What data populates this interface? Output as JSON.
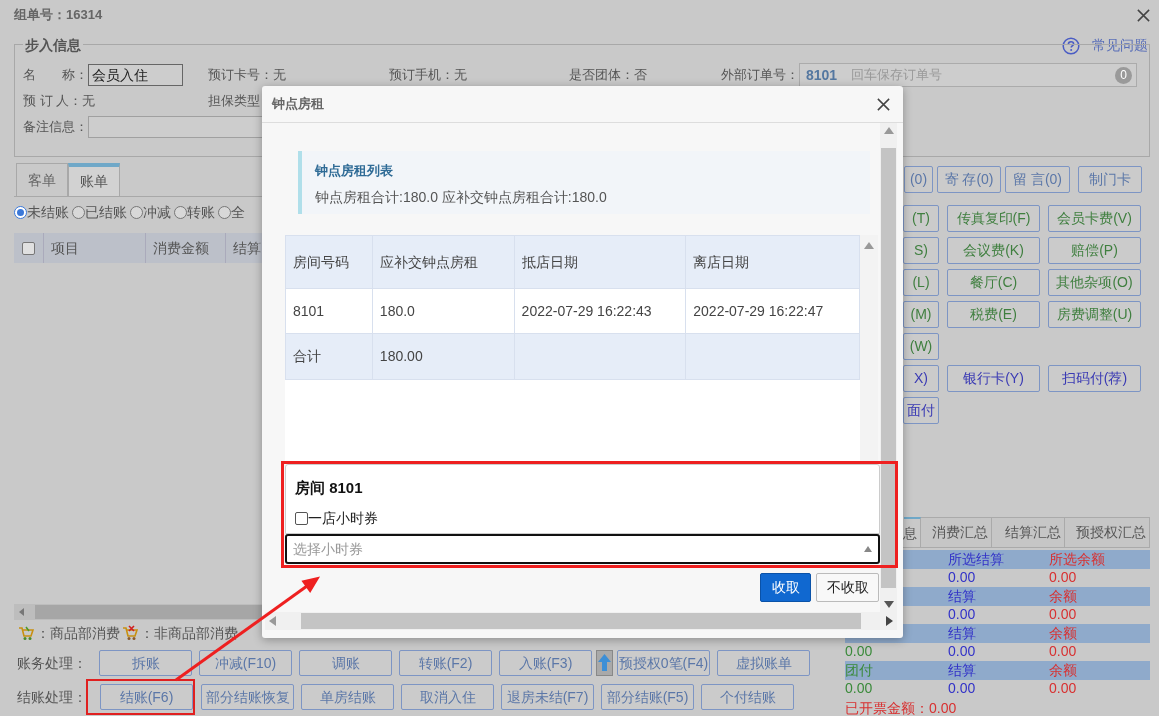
{
  "window": {
    "title": "组单号：16314",
    "help_link": "常见问题"
  },
  "walk_in": {
    "legend": "步入信息",
    "rows": [
      [
        {
          "kind": "input",
          "label": "名　　称：",
          "value": "会员入住"
        },
        {
          "kind": "text",
          "label": "预订卡号：",
          "value": "无"
        },
        {
          "kind": "text",
          "label": "预订手机：",
          "value": "无"
        },
        {
          "kind": "text",
          "label": "是否团体：",
          "value": "否"
        },
        {
          "kind": "order_input",
          "label": "外部订单号：",
          "value": "8101",
          "hint": "回车保存订单号",
          "badge": "0"
        }
      ],
      [
        {
          "kind": "text",
          "label": "预 订 人：",
          "value": "无"
        },
        {
          "kind": "text",
          "label": "担保类型"
        }
      ],
      [
        {
          "kind": "input",
          "label": "备注信息："
        }
      ]
    ]
  },
  "tabs": [
    {
      "label": "客单",
      "selected": false
    },
    {
      "label": "账单",
      "selected": true
    }
  ],
  "bill_filters": [
    {
      "label": "未结账",
      "selected": true
    },
    {
      "label": "已结账",
      "selected": false
    },
    {
      "label": "冲减",
      "selected": false
    },
    {
      "label": "转账",
      "selected": false
    },
    {
      "label": "全",
      "selected": false
    }
  ],
  "bill_table": {
    "checked": false,
    "columns": [
      "项目",
      "消费金额",
      "结算"
    ]
  },
  "legend": [
    {
      "kind": "cart",
      "label": "：商品部消费"
    },
    {
      "kind": "cart_cross",
      "label": "：非商品部消费"
    }
  ],
  "account_actions": {
    "label": "账务处理：",
    "buttons": [
      {
        "kind": "text",
        "label": "拆账"
      },
      {
        "kind": "text",
        "label": "冲减(F10)"
      },
      {
        "kind": "text",
        "label": "调账"
      },
      {
        "kind": "text",
        "label": "转账(F2)"
      },
      {
        "kind": "text",
        "label": "入账(F3)"
      },
      {
        "kind": "icon"
      },
      {
        "kind": "text",
        "label": "预授权0笔(F4)"
      },
      {
        "kind": "text",
        "label": "虚拟账单"
      }
    ]
  },
  "checkout_actions": {
    "label": "结账处理：",
    "buttons": [
      {
        "kind": "text",
        "label": "结账(F6)",
        "highlighted": true
      },
      {
        "kind": "text",
        "label": "部分结账恢复",
        "highlighted": false
      },
      {
        "kind": "text",
        "label": "单房结账",
        "highlighted": false
      },
      {
        "kind": "text",
        "label": "取消入住",
        "highlighted": false
      },
      {
        "kind": "text",
        "label": "退房未结(F7)",
        "highlighted": false
      },
      {
        "kind": "text",
        "label": "部分结账(F5)",
        "highlighted": false
      },
      {
        "kind": "text",
        "label": "个付结账",
        "highlighted": false
      }
    ]
  },
  "right_panel": {
    "top_buttons": [
      "(0)",
      "寄 存(0)",
      "留 言(0)",
      "制门卡"
    ],
    "charge_rows": [
      [
        {
          "kind": "charge",
          "label": "(T)"
        },
        {
          "kind": "charge",
          "label": "传真复印(F)"
        },
        {
          "kind": "charge",
          "label": "会员卡费(V)"
        }
      ],
      [
        {
          "kind": "charge",
          "label": "S)"
        },
        {
          "kind": "charge",
          "label": "会议费(K)"
        },
        {
          "kind": "charge",
          "label": "赔偿(P)"
        }
      ],
      [
        {
          "kind": "charge",
          "label": "(L)"
        },
        {
          "kind": "charge",
          "label": "餐厅(C)"
        },
        {
          "kind": "charge",
          "label": "其他杂项(O)"
        }
      ],
      [
        {
          "kind": "charge",
          "label": "(M)"
        },
        {
          "kind": "charge",
          "label": "税费(E)"
        },
        {
          "kind": "charge",
          "label": "房费调整(U)"
        }
      ],
      [
        {
          "kind": "charge",
          "label": "(W)"
        }
      ],
      [
        {
          "kind": "payment",
          "label": "X)"
        },
        {
          "kind": "payment",
          "label": "银行卡(Y)"
        },
        {
          "kind": "payment",
          "label": "扫码付(荐)"
        }
      ],
      [
        {
          "kind": "payment",
          "label": "面付"
        }
      ]
    ],
    "summary_tabs": [
      {
        "label": "息",
        "selected": true
      },
      {
        "label": "消费汇总",
        "selected": false
      },
      {
        "label": "结算汇总",
        "selected": false
      },
      {
        "label": "预授权汇总",
        "selected": false
      }
    ],
    "summary_rows": [
      {
        "kind": "header",
        "column_2": "所选结算",
        "column_3": "所选余额"
      },
      {
        "kind": "value",
        "column_2": "0.00",
        "column_3": "0.00"
      },
      {
        "kind": "header",
        "column_2": "结算",
        "column_3": "余额"
      },
      {
        "kind": "value",
        "column_2": "0.00",
        "column_3": "0.00"
      },
      {
        "kind": "header",
        "column_2": "结算",
        "column_3": "余额"
      },
      {
        "kind": "value",
        "column_1": "0.00",
        "column_2": "0.00",
        "column_3": "0.00"
      },
      {
        "kind": "header",
        "column_1": "团付",
        "column_2": "结算",
        "column_3": "余额"
      },
      {
        "kind": "value",
        "column_1": "0.00",
        "column_2": "0.00",
        "column_3": "0.00"
      }
    ],
    "invoiced": "已开票金额：0.00"
  },
  "dialog": {
    "title": "钟点房租",
    "notice": {
      "title": "钟点房租列表",
      "text": "钟点房租合计:180.0 应补交钟点房租合计:180.0"
    },
    "table": {
      "columns": [
        "房间号码",
        "应补交钟点房租",
        "抵店日期",
        "离店日期"
      ],
      "rows": [
        {
          "kind": "data",
          "cells": [
            "8101",
            "180.0",
            "2022-07-29 16:22:43",
            "2022-07-29 16:22:47"
          ]
        },
        {
          "kind": "total",
          "cells": [
            "合计",
            "180.00"
          ]
        }
      ]
    },
    "voucher": {
      "room": "房间 8101",
      "highlighted": true,
      "options": [
        {
          "label": "一店小时券",
          "checked": false
        }
      ],
      "placeholder": "选择小时券"
    },
    "buttons": [
      {
        "kind": "primary",
        "label": "收取"
      },
      {
        "kind": "default",
        "label": "不收取"
      }
    ]
  }
}
